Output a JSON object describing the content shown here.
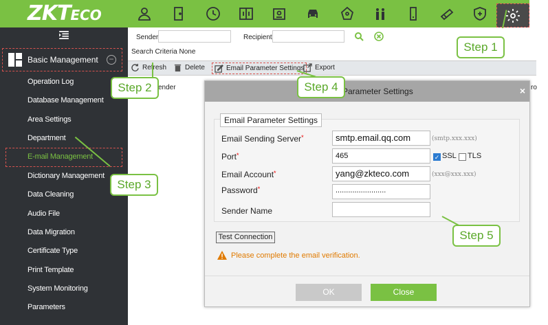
{
  "brand": {
    "logo": "ZKTeco",
    "accent": "#7ac143",
    "sidebar_bg": "#2f3236"
  },
  "top_nav": {
    "icons": [
      "person-icon",
      "door-icon",
      "clock-icon",
      "access-panel-icon",
      "id-card-icon",
      "car-icon",
      "patrol-icon",
      "elevator-icon",
      "phone-icon",
      "pass-icon",
      "shield-icon",
      "gear-icon"
    ]
  },
  "sidebar": {
    "section_title": "Basic Management",
    "items": [
      {
        "label": "Operation Log"
      },
      {
        "label": "Database Management"
      },
      {
        "label": "Area Settings"
      },
      {
        "label": "Department"
      },
      {
        "label": "E-mail Management",
        "active": true
      },
      {
        "label": "Dictionary Management"
      },
      {
        "label": "Data Cleaning"
      },
      {
        "label": "Audio File"
      },
      {
        "label": "Data Migration"
      },
      {
        "label": "Certificate Type"
      },
      {
        "label": "Print Template"
      },
      {
        "label": "System Monitoring"
      },
      {
        "label": "Parameters"
      }
    ]
  },
  "filter": {
    "sender_label": "Sender",
    "recipient_label": "Recipient",
    "criteria": "Search Criteria None"
  },
  "toolbar": {
    "refresh": "Refresh",
    "delete": "Delete",
    "email_params": "Email Parameter Settings",
    "export": "Export"
  },
  "table": {
    "col_sender_partial": "ender",
    "col_right_partial": "ro"
  },
  "dialog": {
    "title_partial": "Parameter Settings",
    "legend": "Email Parameter Settings",
    "server_label": "Email Sending Server",
    "server_value": "smtp.email.qq.com",
    "server_hint": "(smtp.xxx.xxx)",
    "port_label": "Port",
    "port_value": "465",
    "ssl_label": "SSL",
    "ssl_checked": true,
    "tls_label": "TLS",
    "tls_checked": false,
    "account_label": "Email Account",
    "account_value": "yang@zkteco.com",
    "account_hint": "(xxx@xxx.xxx)",
    "password_label": "Password",
    "password_value": "........................",
    "sender_name_label": "Sender Name",
    "sender_name_value": "",
    "test_connection": "Test Connection",
    "warning": "Please complete the email verification.",
    "ok": "OK",
    "close": "Close",
    "close_x": "×"
  },
  "steps": {
    "step1": "Step 1",
    "step2": "Step 2",
    "step3": "Step 3",
    "step4": "Step 4",
    "step5": "Step 5"
  }
}
